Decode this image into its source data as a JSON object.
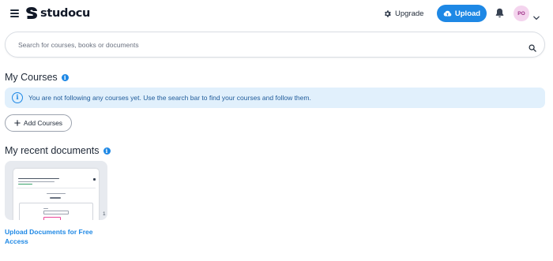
{
  "header": {
    "logo_text": "studocu",
    "upgrade_label": "Upgrade",
    "upload_label": "Upload",
    "avatar_initials": "PO"
  },
  "search": {
    "placeholder": "Search for courses, books or documents",
    "value": ""
  },
  "my_courses": {
    "title": "My Courses",
    "notice": "You are not following any courses yet. Use the search bar to find your courses and follow them.",
    "add_label": "Add Courses"
  },
  "recent_documents": {
    "title": "My recent documents",
    "items": [
      {
        "title": "Upload Documents for Free Access",
        "count": "1"
      }
    ]
  },
  "colors": {
    "accent": "#1e88e5",
    "notice_bg": "#e1f0fc",
    "avatar_bg": "#f4d4ee",
    "avatar_text": "#9d2f86"
  },
  "icons": {
    "menu": "hamburger-icon",
    "upgrade": "gear-icon",
    "upload": "cloud-upload-icon",
    "notifications": "bell-icon",
    "account_menu": "chevron-down-icon",
    "search": "search-icon",
    "info": "info-icon",
    "add": "plus-icon"
  }
}
